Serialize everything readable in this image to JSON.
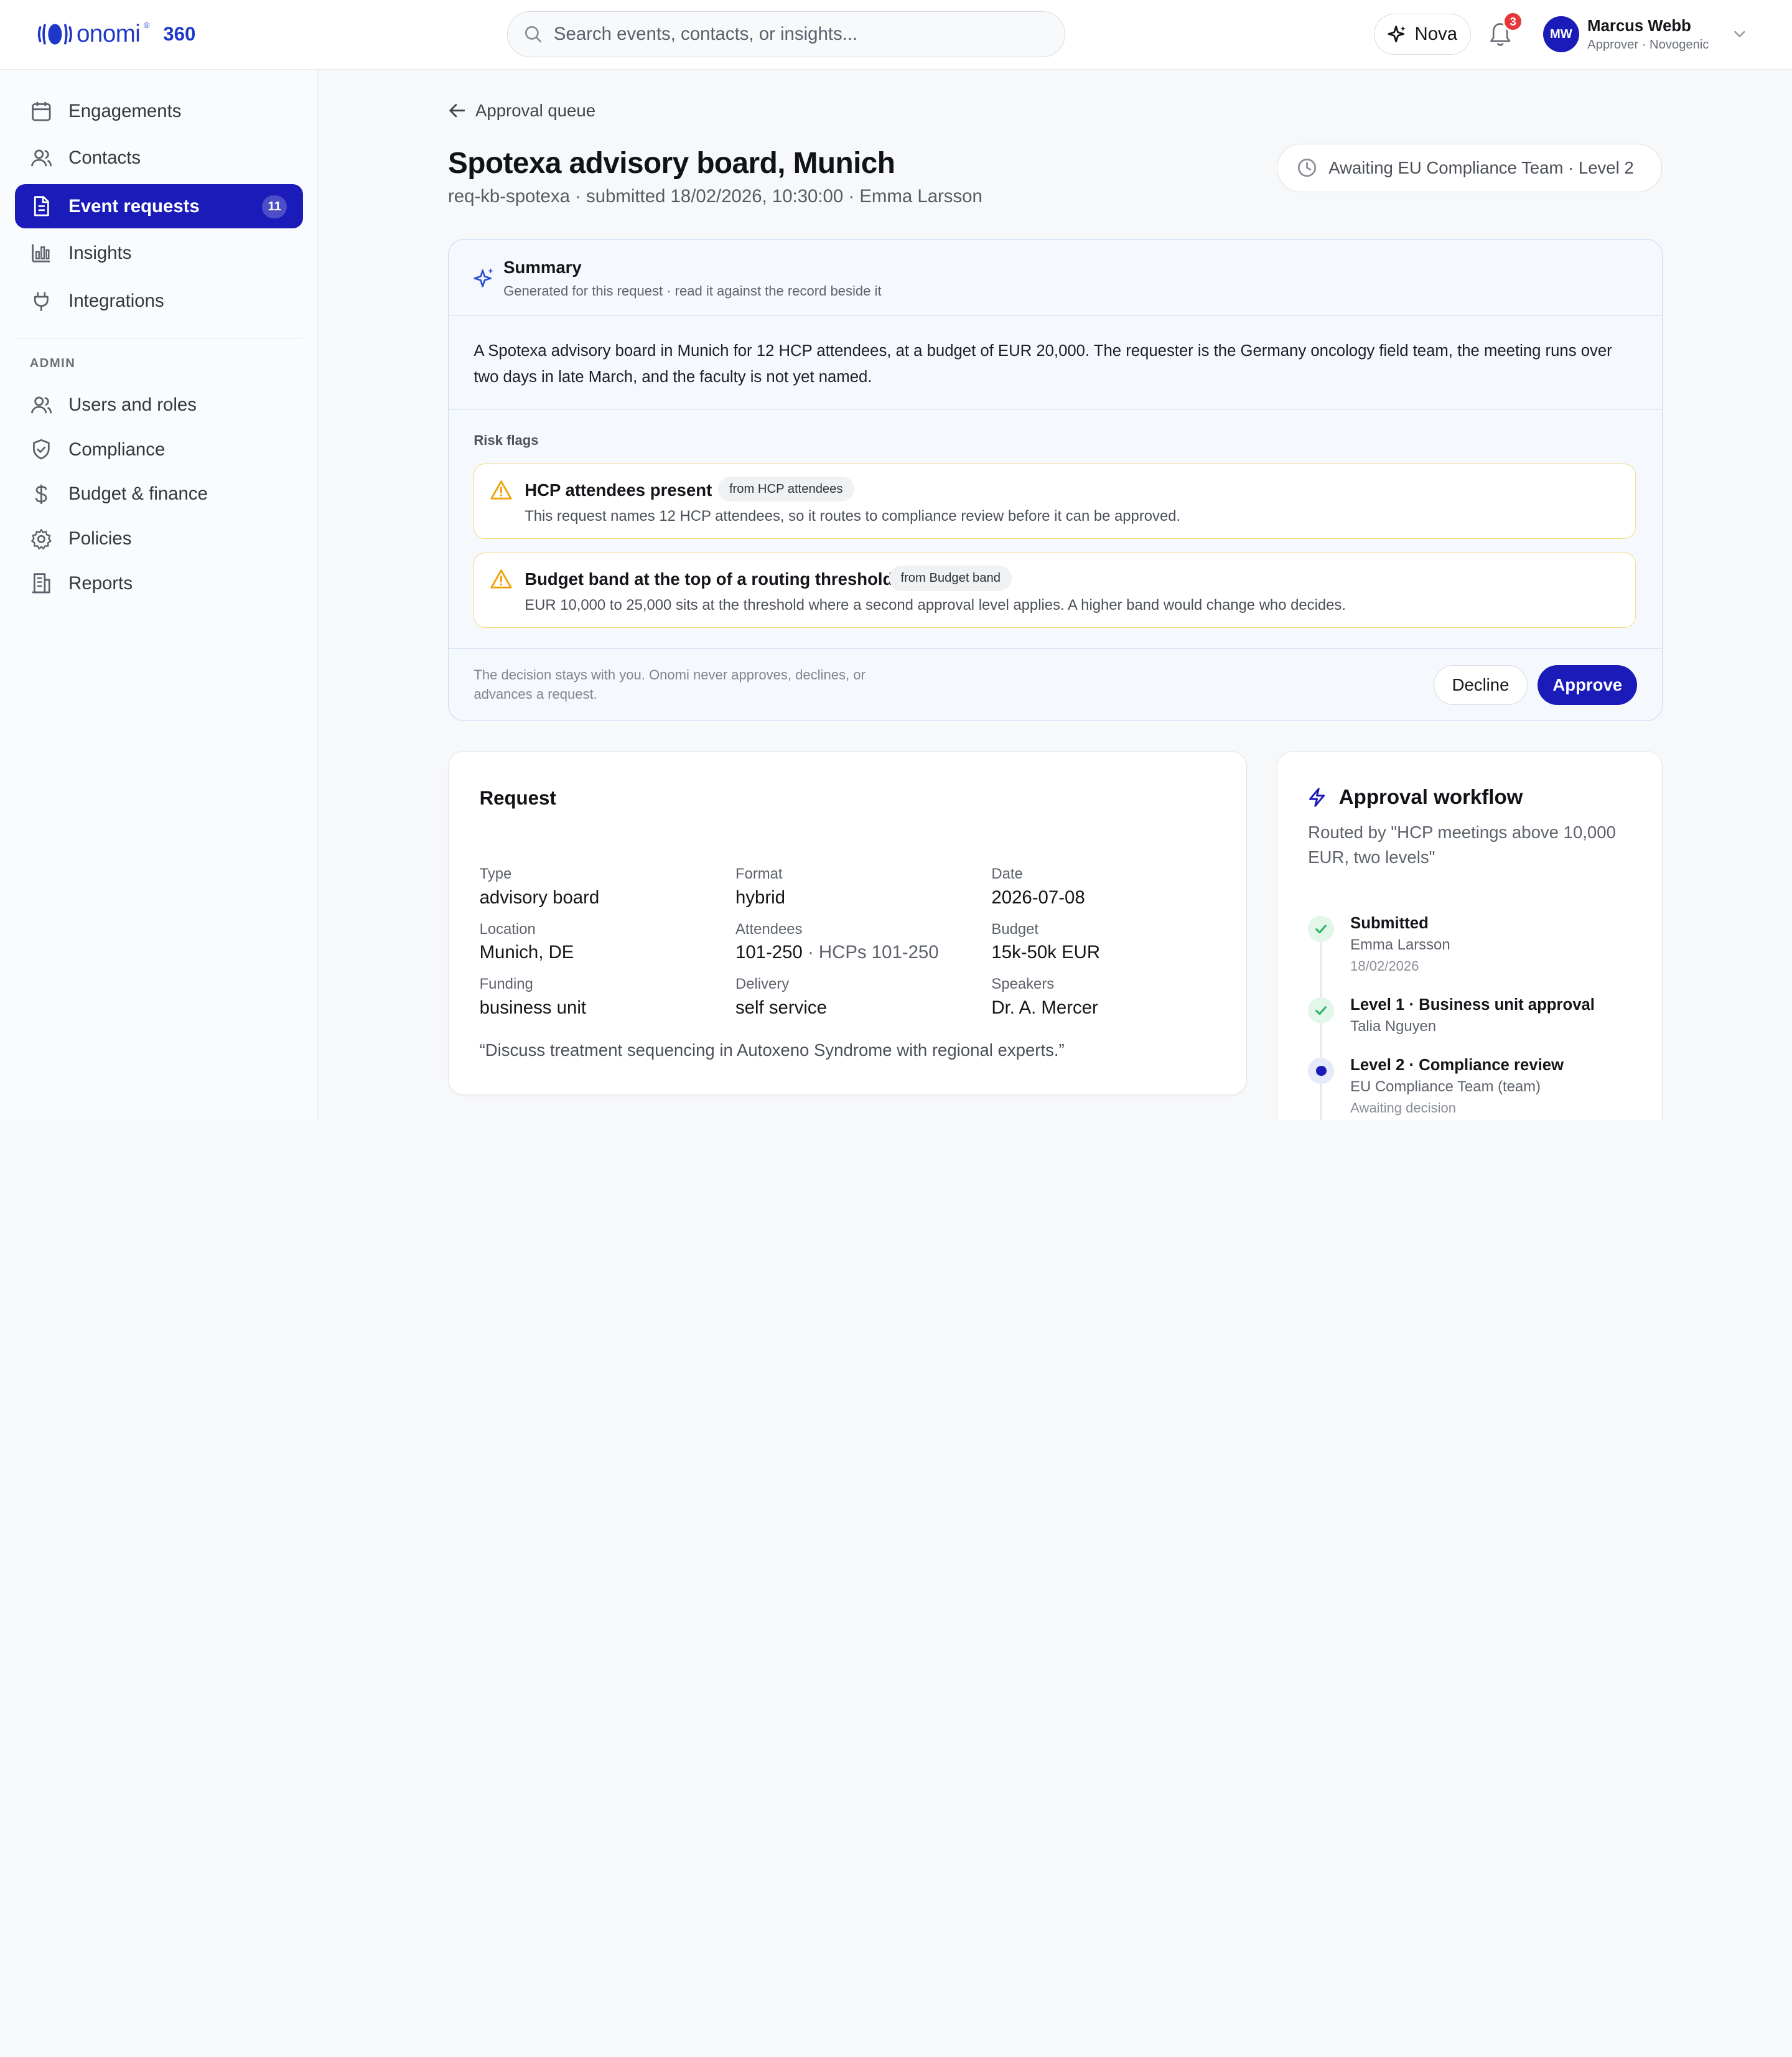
{
  "header": {
    "logo": {
      "word": "onomi",
      "mark_reg": "®",
      "product": "360",
      "brand_color": "#1f37c9"
    },
    "search": {
      "placeholder": "Search events, contacts, or insights...",
      "value": ""
    },
    "nova_label": "Nova",
    "notifications_count": "3",
    "user": {
      "initials": "MW",
      "name": "Marcus Webb",
      "role": "Approver · Novogenic"
    }
  },
  "sidebar": {
    "items": [
      {
        "label": "Engagements",
        "icon": "calendar-icon"
      },
      {
        "label": "Contacts",
        "icon": "users-icon"
      },
      {
        "label": "Event requests",
        "icon": "document-icon",
        "count": "11",
        "active": true
      },
      {
        "label": "Insights",
        "icon": "bar-chart-icon"
      },
      {
        "label": "Integrations",
        "icon": "plug-icon"
      }
    ],
    "admin_label": "ADMIN",
    "admin_items": [
      {
        "label": "Users and roles",
        "icon": "users-icon"
      },
      {
        "label": "Compliance",
        "icon": "shield-icon"
      },
      {
        "label": "Budget & finance",
        "icon": "dollar-icon"
      },
      {
        "label": "Policies",
        "icon": "gear-icon"
      },
      {
        "label": "Reports",
        "icon": "building-icon"
      }
    ]
  },
  "main": {
    "back_label": "Approval queue",
    "title": "Spotexa advisory board, Munich",
    "meta": "req-kb-spotexa · submitted 18/02/2026, 10:30:00 · Emma Larsson",
    "status": "Awaiting EU Compliance Team · Level 2"
  },
  "summary": {
    "title": "Summary",
    "subtitle": "Generated for this request · read it against the record beside it",
    "body": "A Spotexa advisory board in Munich for 12 HCP attendees, at a budget of EUR 20,000. The requester is the Germany oncology field team, the meeting runs over two days in late March, and the faculty is not yet named.",
    "risk_label": "Risk flags",
    "risks": [
      {
        "title": "HCP attendees present",
        "tag": "from HCP attendees",
        "desc": "This request names 12 HCP attendees, so it routes to compliance review before it can be approved."
      },
      {
        "title": "Budget band at the top of a routing threshold",
        "tag": "from Budget band",
        "desc": "EUR 10,000 to 25,000 sits at the threshold where a second approval level applies. A higher band would change who decides."
      }
    ],
    "footnote": "The decision stays with you. Onomi never approves, declines, or advances a request.",
    "decline_label": "Decline",
    "approve_label": "Approve"
  },
  "request": {
    "title": "Request",
    "fields": {
      "type": {
        "label": "Type",
        "value": "advisory board"
      },
      "format": {
        "label": "Format",
        "value": "hybrid"
      },
      "date": {
        "label": "Date",
        "value": "2026-07-08"
      },
      "location": {
        "label": "Location",
        "value": "Munich, DE"
      },
      "attendees": {
        "label": "Attendees",
        "value": "101-250",
        "extra": " · HCPs 101-250"
      },
      "budget": {
        "label": "Budget",
        "value": "15k-50k EUR"
      },
      "funding": {
        "label": "Funding",
        "value": "business unit"
      },
      "delivery": {
        "label": "Delivery",
        "value": "self service"
      },
      "speakers": {
        "label": "Speakers",
        "value": "Dr. A. Mercer"
      }
    },
    "quote": "“Discuss treatment sequencing in Autoxeno Syndrome with regional experts.”"
  },
  "workflow": {
    "title": "Approval workflow",
    "routed": "Routed by \"HCP meetings above 10,000 EUR, two levels\"",
    "steps": [
      {
        "title": "Submitted",
        "who": "Emma Larsson",
        "when": "18/02/2026",
        "state": "done"
      },
      {
        "title": "Level 1 · Business unit approval",
        "who": "Talia Nguyen",
        "state": "done"
      },
      {
        "title": "Level 2 · Compliance review",
        "who": "EU Compliance Team (team)",
        "when": "Awaiting decision",
        "state": "current"
      }
    ]
  },
  "colors": {
    "accent": "#1a1bb8",
    "brand": "#1f37c9",
    "warning": "#f0a20a",
    "success": "#2bb36a",
    "badge": "#e5383b"
  }
}
